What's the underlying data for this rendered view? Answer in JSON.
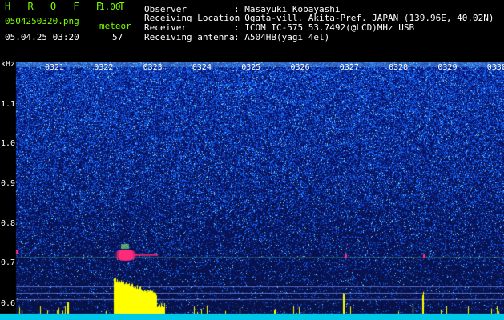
{
  "app": {
    "title": "H R O F F T",
    "version": "1.00"
  },
  "header": {
    "filename": "0504250320.png",
    "mode_label": "meteor",
    "datetime": "05.04.25 03:20",
    "count": "57",
    "observer_label": "Observer",
    "observer_value": ": Masayuki Kobayashi",
    "location_label": "Receiving Location",
    "location_value": ": Ogata-vill. Akita-Pref. JAPAN (139.96E, 40.02N)",
    "receiver_label": "Receiver",
    "receiver_value": ": ICOM IC-575 53.7492(@LCD)MHz USB",
    "antenna_label": "Receiving antenna",
    "antenna_value": ": A504HB(yagi 4el)"
  },
  "spectrogram": {
    "unit_label": "kHz",
    "time_ticks": [
      "0321",
      "0322",
      "0323",
      "0324",
      "0325",
      "0326",
      "0327",
      "0328",
      "0329",
      "0330"
    ],
    "freq_ticks": [
      "1.1",
      "1.0",
      "0.9",
      "0.8",
      "0.7",
      "0.6"
    ],
    "colors": {
      "background": "#0a1a6e",
      "noise": "#1f78ff",
      "echo": "#ff2a7a",
      "bars": "#ffff00",
      "baseline": "#00e5ff"
    }
  }
}
